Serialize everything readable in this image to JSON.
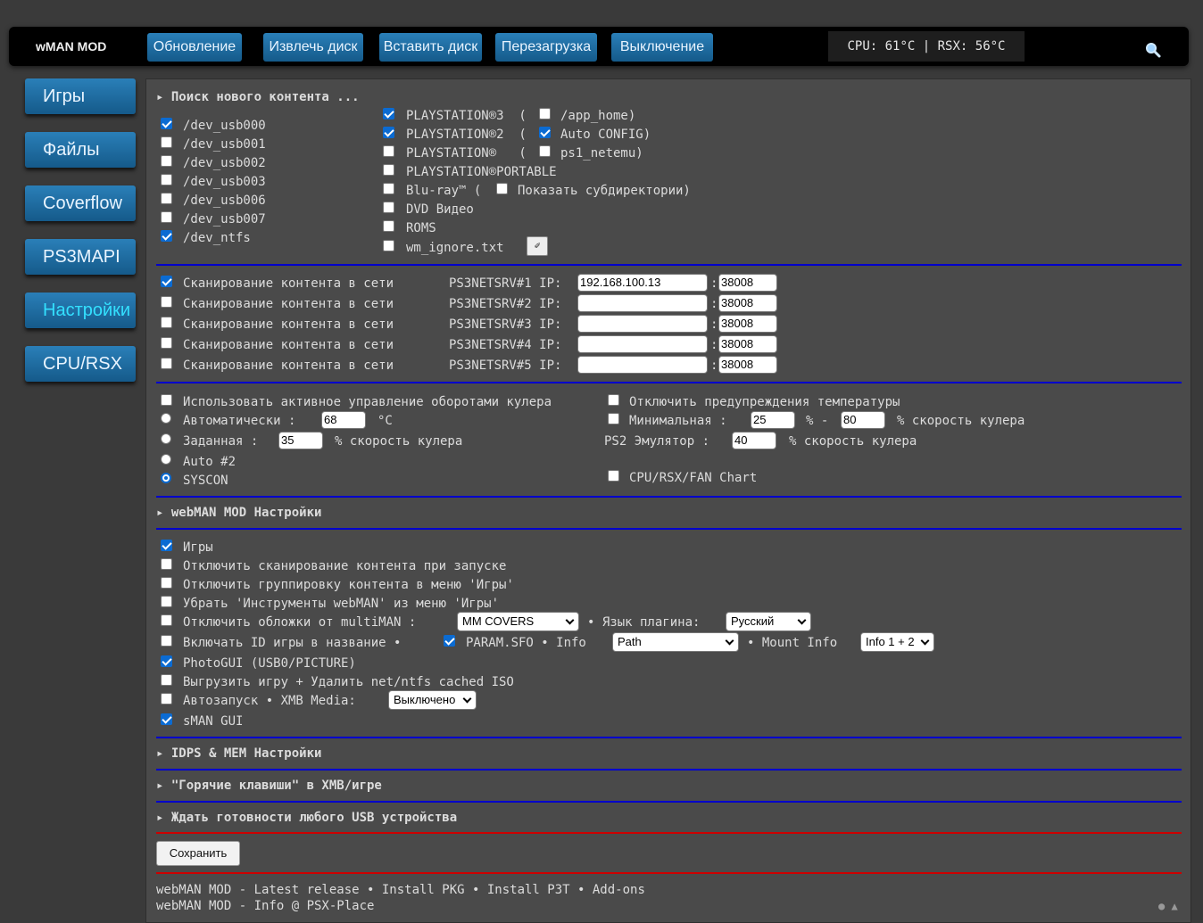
{
  "app": {
    "logo": "wMAN MOD"
  },
  "toolbar": {
    "buttons": [
      "Обновление",
      "Извлечь диск",
      "Вставить диск",
      "Перезагрузка",
      "Выключение"
    ],
    "temps": "CPU: 61°C | RSX: 56°C"
  },
  "sidebar": {
    "items": [
      "Игры",
      "Файлы",
      "Coverflow",
      "PS3MAPI",
      "Настройки",
      "CPU/RSX"
    ],
    "active": "Настройки"
  },
  "scan": {
    "header": "▸ Поиск нового контента ...",
    "devices": [
      {
        "label": "/dev_usb000",
        "checked": true
      },
      {
        "label": "/dev_usb001",
        "checked": false
      },
      {
        "label": "/dev_usb002",
        "checked": false
      },
      {
        "label": "/dev_usb003",
        "checked": false
      },
      {
        "label": "/dev_usb006",
        "checked": false
      },
      {
        "label": "/dev_usb007",
        "checked": false
      },
      {
        "label": "/dev_ntfs",
        "checked": true
      }
    ],
    "types": [
      {
        "label": "PLAYSTATION®3  (",
        "checked": true,
        "extra": {
          "label": "/app_home)",
          "checked": false
        }
      },
      {
        "label": "PLAYSTATION®2  (",
        "checked": true,
        "extra": {
          "label": "Auto CONFIG)",
          "checked": true
        }
      },
      {
        "label": "PLAYSTATION®   (",
        "checked": false,
        "extra": {
          "label": "ps1_netemu)",
          "checked": false
        }
      },
      {
        "label": "PLAYSTATION®PORTABLE",
        "checked": false
      },
      {
        "label": "Blu-ray™ (",
        "checked": false,
        "extra": {
          "label": "Показать субдиректории)",
          "checked": false
        }
      },
      {
        "label": "DVD Видео",
        "checked": false
      },
      {
        "label": "ROMS",
        "checked": false
      },
      {
        "label": "wm_ignore.txt",
        "checked": false
      }
    ],
    "edit_icon": "✐"
  },
  "net": {
    "rows": [
      {
        "label": "Сканирование контента в сети",
        "server": "PS3NETSRV#1 IP:",
        "ip": "192.168.100.13",
        "port": "38008",
        "checked": true
      },
      {
        "label": "Сканирование контента в сети",
        "server": "PS3NETSRV#2 IP:",
        "ip": "",
        "port": "38008",
        "checked": false
      },
      {
        "label": "Сканирование контента в сети",
        "server": "PS3NETSRV#3 IP:",
        "ip": "",
        "port": "38008",
        "checked": false
      },
      {
        "label": "Сканирование контента в сети",
        "server": "PS3NETSRV#4 IP:",
        "ip": "",
        "port": "38008",
        "checked": false
      },
      {
        "label": "Сканирование контента в сети",
        "server": "PS3NETSRV#5 IP:",
        "ip": "",
        "port": "38008",
        "checked": false
      }
    ]
  },
  "fan": {
    "active_control": "Использовать активное управление оборотами кулера",
    "disable_warnings": "Отключить предупреждения температуры",
    "auto": "Автоматически :",
    "auto_value": "68",
    "auto_unit": "°C",
    "min": "Минимальная :",
    "min_value": "25",
    "min_sep": "% -",
    "max_value": "80",
    "speed_label": "% скорость кулера",
    "fixed": "Заданная :",
    "fixed_value": "35",
    "ps2emu": "PS2 Эмулятор :",
    "ps2emu_value": "40",
    "auto2": "Auto #2",
    "syscon": "SYSCON",
    "chart": "CPU/RSX/FAN Chart"
  },
  "webman": {
    "header": "▸ webMAN MOD Настройки",
    "opts": [
      {
        "label": "Игры",
        "checked": true
      },
      {
        "label": "Отключить сканирование контента при запуске",
        "checked": false
      },
      {
        "label": "Отключить группировку контента в меню 'Игры'",
        "checked": false
      },
      {
        "label": "Убрать 'Инструменты webMAN' из меню 'Игры'",
        "checked": false
      },
      {
        "label": "Отключить обложки от multiMAN :",
        "checked": false
      },
      {
        "label": "Включать ID игры в название •",
        "checked": false
      },
      {
        "label": "PhotoGUI (USB0/PICTURE)",
        "checked": true
      },
      {
        "label": "Выгрузить игру + Удалить net/ntfs cached ISO",
        "checked": false
      },
      {
        "label": "Автозапуск • XMB Media:",
        "checked": false
      },
      {
        "label": "sMAN GUI",
        "checked": true
      }
    ],
    "covers_select": "MM COVERS",
    "lang_label": "• Язык плагина:",
    "lang_select": "Русский",
    "paramsfo_label": "PARAM.SFO • Info",
    "paramsfo_checked": true,
    "info_select": "Path",
    "mount_label": "• Mount Info",
    "mount_select": "Info 1 + 2",
    "xmb_select": "Выключено"
  },
  "sections": {
    "idps": "▸ IDPS & MEM Настройки",
    "hotkeys": "▸ \"Горячие клавиши\" в XMB/игре",
    "usbwait": "▸ Ждать готовности любого USB устройства"
  },
  "save_label": "Сохранить",
  "footer": {
    "line1": "webMAN MOD - Latest release • Install PKG • Install P3T • Add-ons",
    "line2": "webMAN MOD - Info @ PSX-Place"
  },
  "colors": {
    "accent": "#2a7fb8",
    "active_nav": "#33e0ff",
    "separator_blue": "#0000cc",
    "separator_red": "#cc0000"
  }
}
